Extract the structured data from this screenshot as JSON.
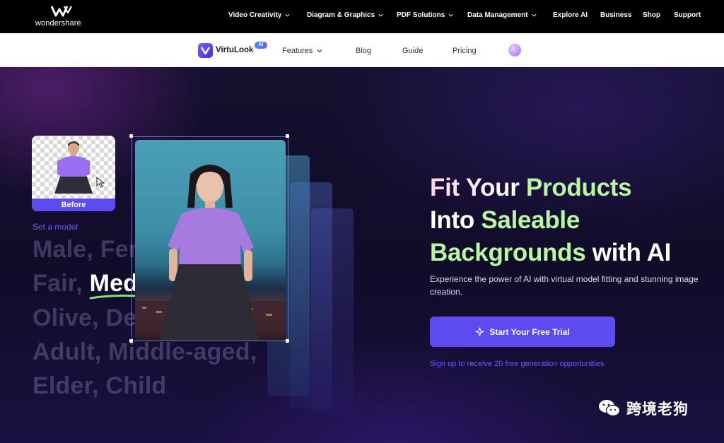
{
  "brand": {
    "name": "wondershare"
  },
  "topnav": {
    "items": [
      {
        "label": "Video Creativity",
        "dropdown": true
      },
      {
        "label": "Diagram & Graphics",
        "dropdown": true
      },
      {
        "label": "PDF Solutions",
        "dropdown": true
      },
      {
        "label": "Data Management",
        "dropdown": true
      },
      {
        "label": "Explore AI",
        "dropdown": false
      },
      {
        "label": "Business",
        "dropdown": false
      },
      {
        "label": "Shop",
        "dropdown": false
      },
      {
        "label": "Support",
        "dropdown": false
      }
    ]
  },
  "subnav": {
    "product": "VirtuLook",
    "badge": "AI",
    "items": [
      {
        "label": "Features",
        "dropdown": true
      },
      {
        "label": "Blog"
      },
      {
        "label": "Guide"
      },
      {
        "label": "Pricing"
      }
    ]
  },
  "hero": {
    "before_label": "Before",
    "set_model_label": "Set a model",
    "options": {
      "line1": "Male, Female,",
      "line2_prefix": "Fair, ",
      "line2_highlight": "Medium,",
      "line3": "Olive, Deep,",
      "line4": "Adult, Middle-aged,",
      "line5": "Elder, Child"
    },
    "headline": {
      "l1a": "Fit Your ",
      "l1b": "Products",
      "l2a": "Into ",
      "l2b": "Saleable",
      "l3a": "Backgrounds",
      "l3b": " with AI"
    },
    "subtitle": "Experience the power of AI with virtual model fitting and stunning image creation.",
    "cta_label": "Start Your Free Trial",
    "signup_note": "Sign up to receive 20 free generation opportunities"
  },
  "watermark": {
    "text": "跨境老狗"
  },
  "colors": {
    "accent": "#5b4bf0",
    "green": "#b6f7a0",
    "topbar": "#000000",
    "bg": "#110c2a"
  }
}
